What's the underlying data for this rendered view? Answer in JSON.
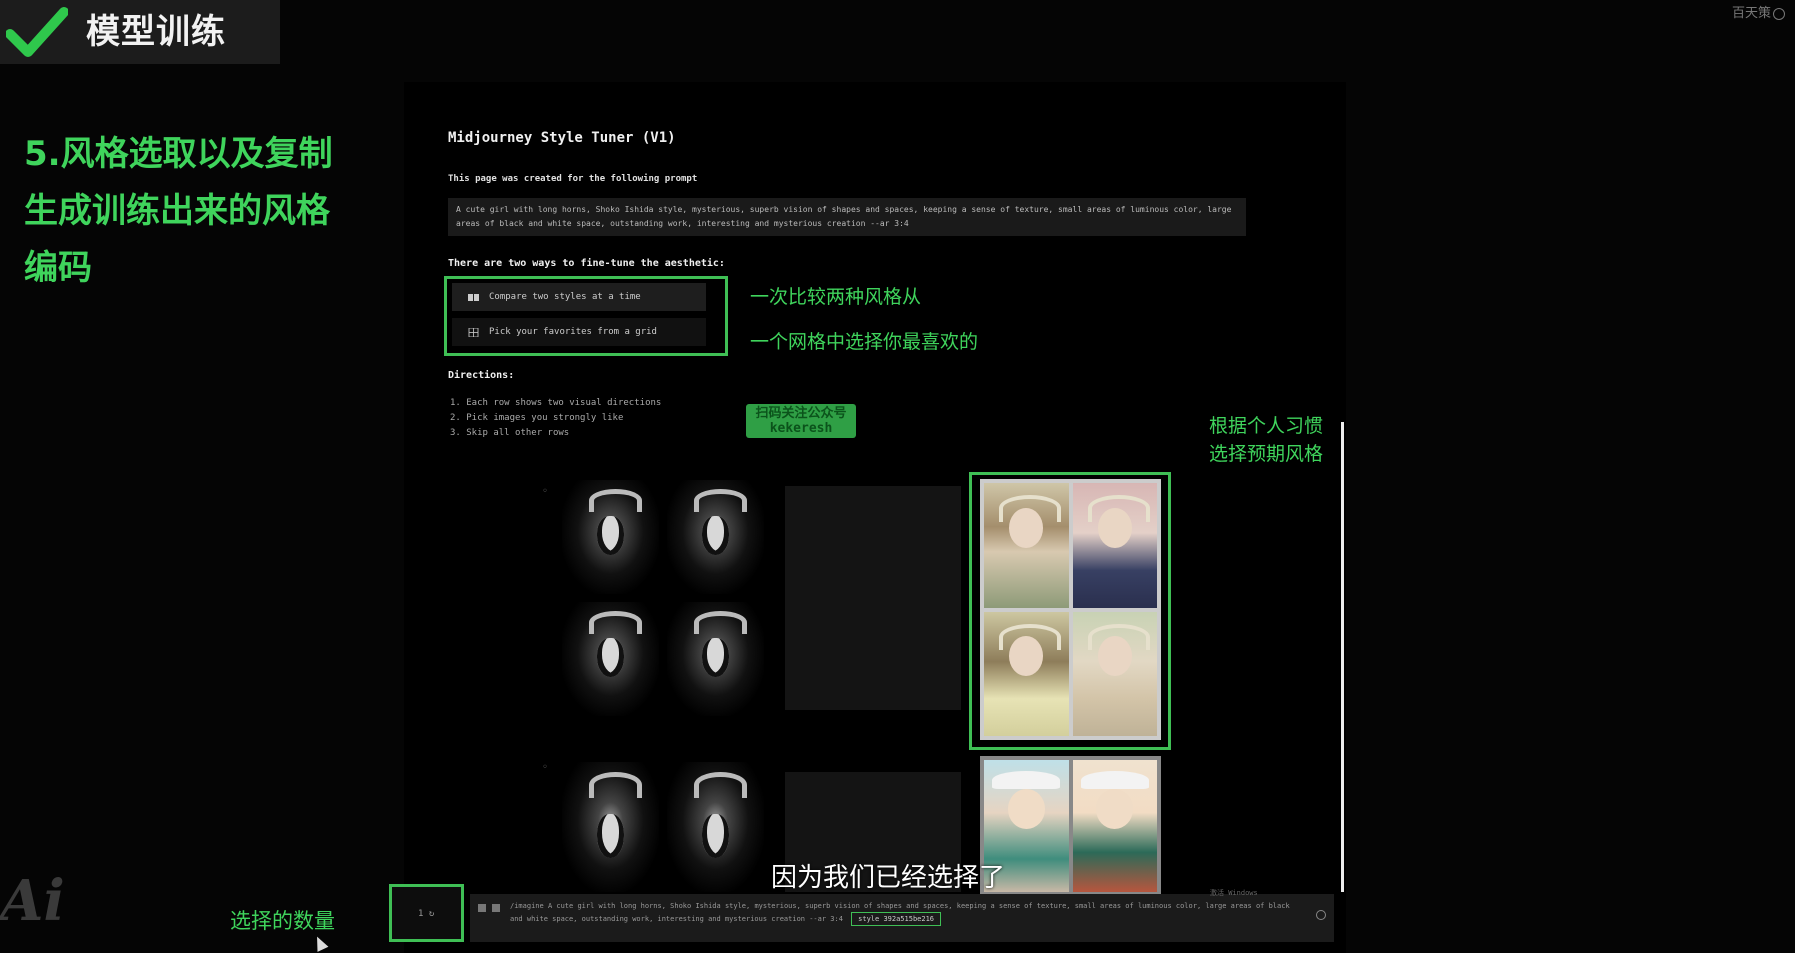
{
  "slide": {
    "title": "模型训练",
    "corner": "百天策",
    "step_heading_lines": [
      "5.风格选取以及复制",
      "生成训练出来的风格",
      "编码"
    ],
    "count_label": "选择的数量",
    "logo": "Ai",
    "subtitle": "因为我们已经选择了"
  },
  "tuner": {
    "title": "Midjourney Style Tuner (V1)",
    "prompt_label": "This page was created for the following prompt",
    "prompt_text": "A cute girl with long horns, Shoko Ishida style, mysterious, superb vision of shapes and spaces, keeping a sense of texture, small areas of luminous color, large areas of black and white space, outstanding work, interesting and mysterious creation --ar 3:4",
    "ways_label": "There are two ways to fine-tune the aesthetic:",
    "way_compare": "Compare two styles at a time",
    "way_grid": "Pick your favorites from a grid",
    "annot_ways_1": "一次比较两种风格从",
    "annot_ways_2": "一个网格中选择你最喜欢的",
    "directions_label": "Directions:",
    "directions": [
      "1. Each row shows two visual directions",
      "2. Pick images you strongly like",
      "3. Skip all other rows"
    ],
    "watermark_line1": "扫码关注公众号",
    "watermark_line2": "kekeresh",
    "annot_habit_1": "根据个人习惯",
    "annot_habit_2": "选择预期风格",
    "bottom_prompt_prefix": "/imagine",
    "bottom_prompt": "A cute girl with long horns, Shoko Ishida style, mysterious, superb vision of shapes and spaces, keeping a sense of texture, small areas of luminous color, large areas of black and white space, outstanding work, interesting and mysterious creation --ar 3:4",
    "style_code": "style 392a515be216",
    "count_value": "1 ↻",
    "windows_mark": "激活 Windows"
  },
  "colors": {
    "accent_green": "#3fd45c",
    "highlight_border": "#3fbf55"
  }
}
